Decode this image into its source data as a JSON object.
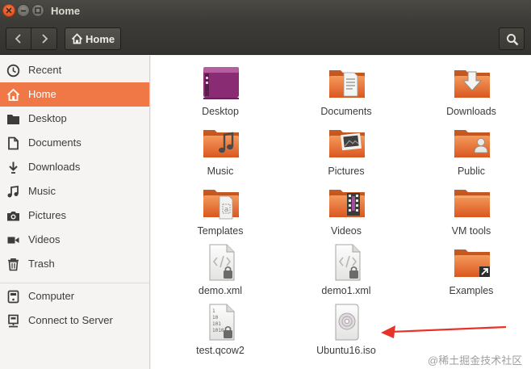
{
  "window": {
    "title": "Home"
  },
  "header": {
    "path_label": "Home"
  },
  "sidebar": {
    "items": [
      {
        "label": "Recent",
        "icon": "clock-icon"
      },
      {
        "label": "Home",
        "icon": "home-icon",
        "active": true
      },
      {
        "label": "Desktop",
        "icon": "folder-icon"
      },
      {
        "label": "Documents",
        "icon": "document-icon"
      },
      {
        "label": "Downloads",
        "icon": "download-icon"
      },
      {
        "label": "Music",
        "icon": "music-icon"
      },
      {
        "label": "Pictures",
        "icon": "camera-icon"
      },
      {
        "label": "Videos",
        "icon": "video-icon"
      },
      {
        "label": "Trash",
        "icon": "trash-icon"
      },
      {
        "label": "Computer",
        "icon": "computer-icon"
      },
      {
        "label": "Connect to Server",
        "icon": "server-icon"
      }
    ]
  },
  "files": [
    {
      "label": "Desktop",
      "icon": "desktop-folder-icon"
    },
    {
      "label": "Documents",
      "icon": "documents-folder-icon"
    },
    {
      "label": "Downloads",
      "icon": "downloads-folder-icon"
    },
    {
      "label": "Music",
      "icon": "music-folder-icon"
    },
    {
      "label": "Pictures",
      "icon": "pictures-folder-icon"
    },
    {
      "label": "Public",
      "icon": "public-folder-icon"
    },
    {
      "label": "Templates",
      "icon": "templates-folder-icon"
    },
    {
      "label": "Videos",
      "icon": "videos-folder-icon"
    },
    {
      "label": "VM tools",
      "icon": "folder-icon"
    },
    {
      "label": "demo.xml",
      "icon": "xml-file-locked-icon"
    },
    {
      "label": "demo1.xml",
      "icon": "xml-file-locked-icon"
    },
    {
      "label": "Examples",
      "icon": "examples-folder-link-icon"
    },
    {
      "label": "test.qcow2",
      "icon": "binary-file-locked-icon"
    },
    {
      "label": "Ubuntu16.iso",
      "icon": "disc-image-icon"
    }
  ],
  "watermark": "@稀土掘金技术社区",
  "colors": {
    "accent": "#f07746",
    "folder": "#e8722f",
    "titlebar": "#3c3b37",
    "annotation_arrow": "#e8332a"
  }
}
